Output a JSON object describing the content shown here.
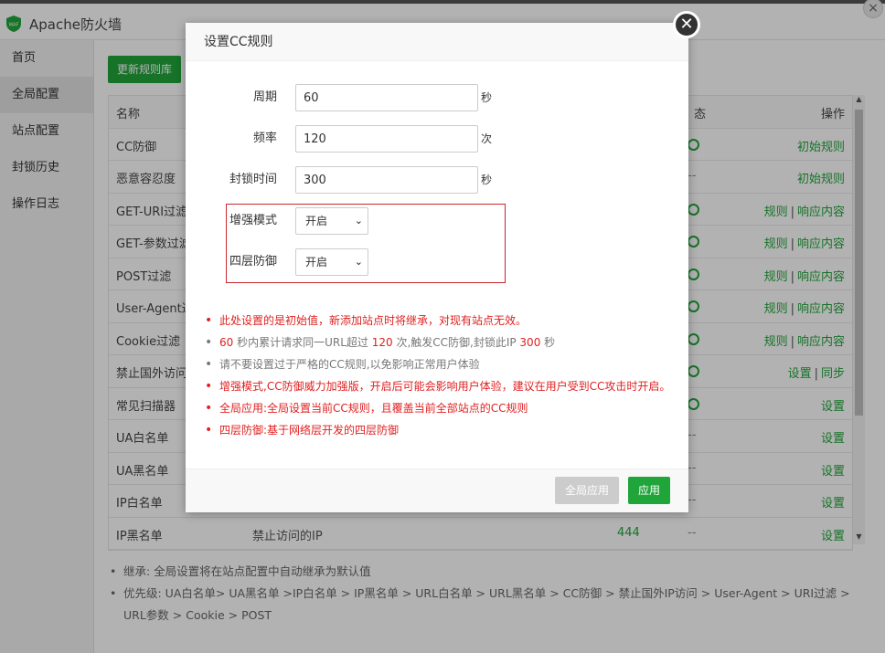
{
  "app": {
    "title": "Apache防火墙",
    "close_glyph": "×"
  },
  "sidebar": {
    "items": [
      {
        "label": "首页"
      },
      {
        "label": "全局配置"
      },
      {
        "label": "站点配置"
      },
      {
        "label": "封锁历史"
      },
      {
        "label": "操作日志"
      }
    ]
  },
  "toolbar": {
    "update_rules_label": "更新规则库"
  },
  "table": {
    "headers": {
      "name": "名称",
      "status": "态",
      "ops": "操作"
    },
    "rows": [
      {
        "name": "CC防御",
        "desc": "",
        "count": "",
        "status": "on",
        "ops": [
          "初始规则"
        ]
      },
      {
        "name": "恶意容忍度",
        "desc": "",
        "count": "",
        "status": "--",
        "ops": [
          "初始规则"
        ]
      },
      {
        "name": "GET-URI过滤",
        "desc": "",
        "count": "",
        "status": "on",
        "ops": [
          "规则",
          "响应内容"
        ]
      },
      {
        "name": "GET-参数过滤",
        "desc": "",
        "count": "",
        "status": "on",
        "ops": [
          "规则",
          "响应内容"
        ]
      },
      {
        "name": "POST过滤",
        "desc": "",
        "count": "",
        "status": "on",
        "ops": [
          "规则",
          "响应内容"
        ]
      },
      {
        "name": "User-Agent过",
        "desc": "",
        "count": "",
        "status": "on",
        "ops": [
          "规则",
          "响应内容"
        ]
      },
      {
        "name": "Cookie过滤",
        "desc": "",
        "count": "",
        "status": "on",
        "ops": [
          "规则",
          "响应内容"
        ]
      },
      {
        "name": "禁止国外访问",
        "desc": "",
        "count": "",
        "status": "on",
        "ops": [
          "设置",
          "同步"
        ]
      },
      {
        "name": "常见扫描器",
        "desc": "",
        "count": "",
        "status": "on",
        "ops": [
          "设置"
        ]
      },
      {
        "name": "UA白名单",
        "desc": "",
        "count": "",
        "status": "--",
        "ops": [
          "设置"
        ]
      },
      {
        "name": "UA黑名单",
        "desc": "",
        "count": "",
        "status": "--",
        "ops": [
          "设置"
        ]
      },
      {
        "name": "IP白名单",
        "desc": "",
        "count": "",
        "status": "--",
        "ops": [
          "设置"
        ]
      },
      {
        "name": "IP黑名单",
        "desc": "禁止访问的IP",
        "count": "444",
        "status": "--",
        "ops": [
          "设置"
        ]
      }
    ]
  },
  "notes": [
    "继承: 全局设置将在站点配置中自动继承为默认值",
    "优先级: UA白名单> UA黑名单 >IP白名单 > IP黑名单 > URL白名单 > URL黑名单 > CC防御 > 禁止国外IP访问 > User-Agent > URI过滤 > URL参数 > Cookie > POST"
  ],
  "modal": {
    "title": "设置CC规则",
    "close_glyph": "✕",
    "period": {
      "label": "周期",
      "value": "60",
      "unit": "秒"
    },
    "frequency": {
      "label": "频率",
      "value": "120",
      "unit": "次"
    },
    "block_time": {
      "label": "封锁时间",
      "value": "300",
      "unit": "秒"
    },
    "enhanced_mode": {
      "label": "增强模式",
      "value": "开启"
    },
    "layer4": {
      "label": "四层防御",
      "value": "开启"
    },
    "tips": {
      "t1": "此处设置的是初始值，新添加站点时将继承，对现有站点无效。",
      "t2_a": "60",
      "t2_b": " 秒内累计请求同一URL超过 ",
      "t2_c": "120",
      "t2_d": " 次,触发CC防御,封锁此IP ",
      "t2_e": "300",
      "t2_f": " 秒",
      "t3": "请不要设置过于严格的CC规则,以免影响正常用户体验",
      "t4": "增强模式,CC防御威力加强版，开启后可能会影响用户体验，建议在用户受到CC攻击时开启。",
      "t5": "全局应用:全局设置当前CC规则，且覆盖当前全部站点的CC规则",
      "t6": "四层防御:基于网络层开发的四层防御"
    },
    "btn_global": "全局应用",
    "btn_apply": "应用"
  },
  "colors": {
    "accent": "#20a53a",
    "warning": "#e02020",
    "disabled": "#cccccc"
  }
}
